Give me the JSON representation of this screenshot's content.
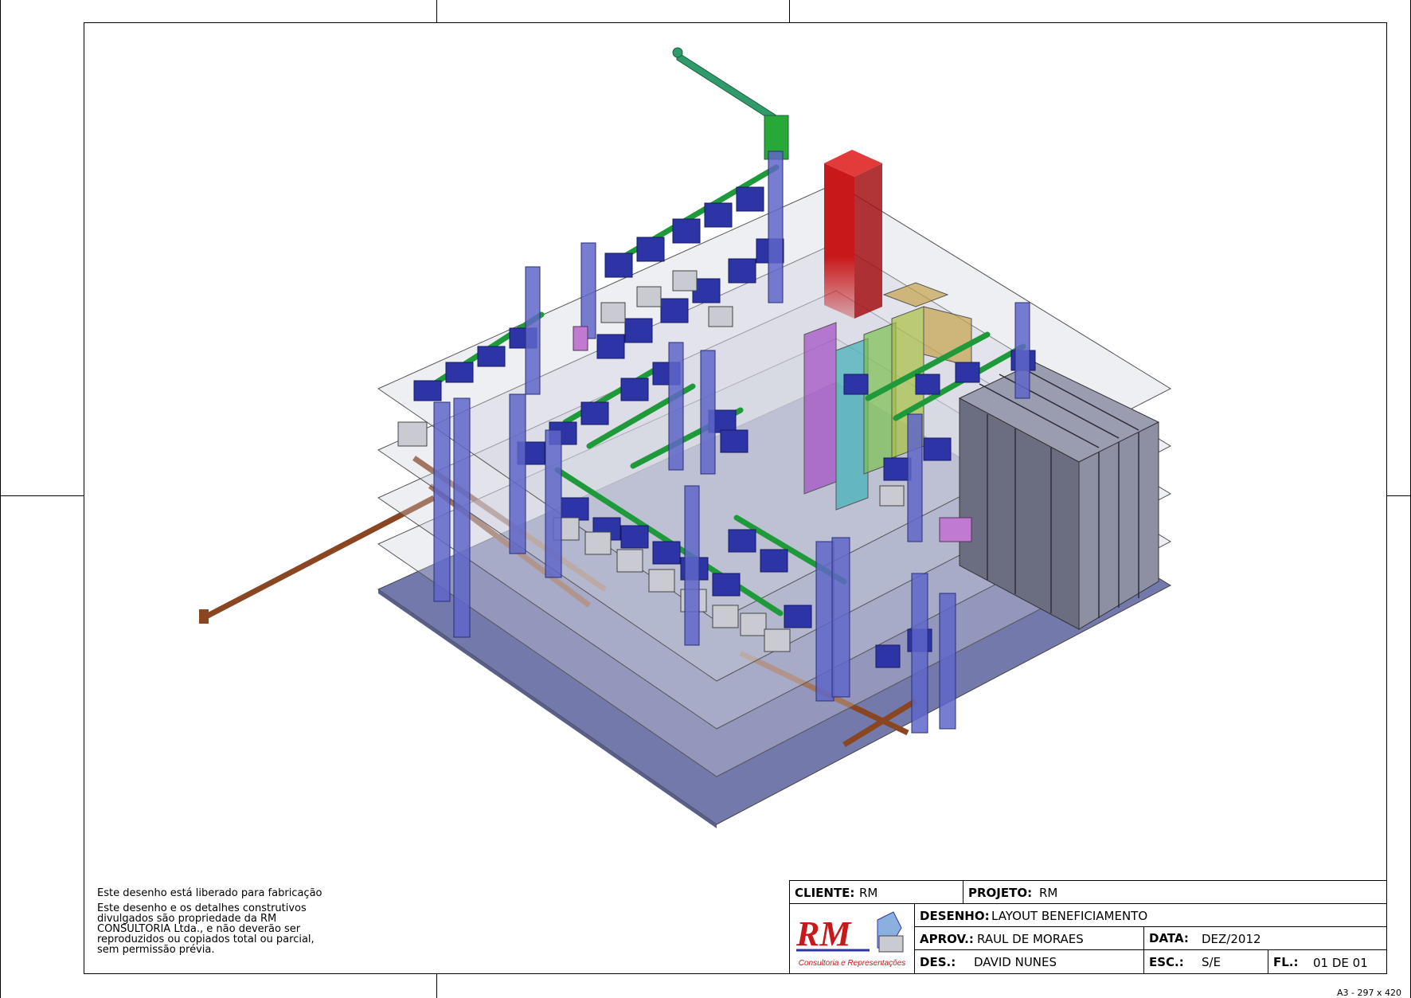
{
  "colors": {
    "floor": "#6f74a6",
    "slab": "#c9cad6",
    "column": "#5f66c8",
    "conveyor_green": "#1f9a3a",
    "pipe_orange": "#9a4e1f",
    "tower_red": "#c8181a",
    "silos": [
      "#a24cc4",
      "#3fb1b8",
      "#7cc04e",
      "#c4a24a"
    ],
    "bins": "#4a4d66",
    "machines": "#2d34a6"
  },
  "notes": {
    "release": "Este desenho está liberado para fabricação",
    "ownership_1": "Este desenho e os detalhes construtivos",
    "ownership_2": "divulgados são propriedade da RM",
    "ownership_3": "CONSULTORIA Ltda., e não deverão ser",
    "ownership_4": "reproduzidos ou copiados total ou parcial,",
    "ownership_5": "sem permissão prévia."
  },
  "title_block": {
    "cliente_label": "CLIENTE:",
    "cliente": "RM",
    "projeto_label": "PROJETO:",
    "projeto": "RM",
    "desenho_label": "DESENHO:",
    "desenho": "LAYOUT BENEFICIAMENTO",
    "aprov_label": "APROV.:",
    "aprov": "RAUL DE MORAES",
    "data_label": "DATA:",
    "data": "DEZ/2012",
    "des_label": "DES.:",
    "des": "DAVID NUNES",
    "esc_label": "ESC.:",
    "esc": "S/E",
    "fl_label": "FL.:",
    "fl": "01 DE 01",
    "logo_text": "RM",
    "logo_caption": "Consultoria e Representações"
  },
  "sheet_size": "A3 - 297 x 420"
}
